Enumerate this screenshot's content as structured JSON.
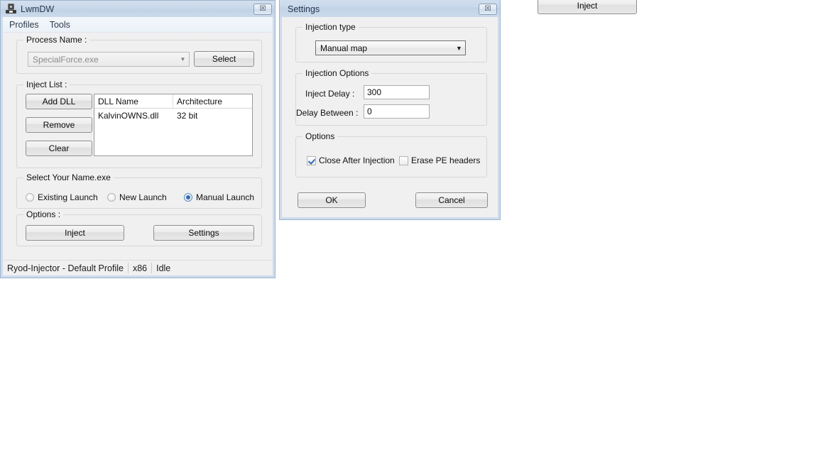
{
  "main_window": {
    "title": "LwmDW",
    "icon": "injector-app-icon",
    "close_label": "☒",
    "menu": [
      {
        "label": "Profiles"
      },
      {
        "label": "Tools"
      }
    ],
    "process_group": {
      "legend": "Process Name :",
      "combo_value": "SpecialForce.exe",
      "select_button": "Select"
    },
    "inject_list_group": {
      "legend": "Inject List :",
      "buttons": [
        {
          "label": "Add DLL"
        },
        {
          "label": "Remove"
        },
        {
          "label": "Clear"
        }
      ],
      "columns": [
        "DLL Name",
        "Architecture"
      ],
      "rows": [
        {
          "dll_name": "KalvinOWNS.dll",
          "architecture": "32 bit"
        }
      ]
    },
    "launch_group": {
      "legend": "Select Your Name.exe",
      "options": [
        {
          "label": "Existing Launch",
          "checked": false
        },
        {
          "label": "New Launch",
          "checked": false
        },
        {
          "label": "Manual Launch",
          "checked": true
        }
      ]
    },
    "options_group": {
      "legend": "Options :",
      "inject_button": "Inject",
      "settings_button": "Settings"
    },
    "statusbar": {
      "profile": "Ryod-Injector - Default Profile",
      "architecture": "x86",
      "state": "Idle"
    }
  },
  "settings_window": {
    "title": "Settings",
    "close_label": "☒",
    "injection_type_group": {
      "legend": "Injection type",
      "selected": "Manual map"
    },
    "injection_options_group": {
      "legend": "Injection Options",
      "inject_delay_label": "Inject Delay :",
      "inject_delay_value": "300",
      "delay_between_label": "Delay Between :",
      "delay_between_value": "0"
    },
    "options_group": {
      "legend": "Options",
      "close_after_injection": {
        "label": "Close After Injection",
        "checked": true
      },
      "erase_pe_headers": {
        "label": "Erase PE headers",
        "checked": false
      }
    },
    "ok_button": "OK",
    "cancel_button": "Cancel"
  },
  "floating_inject_button": {
    "label": "Inject"
  }
}
